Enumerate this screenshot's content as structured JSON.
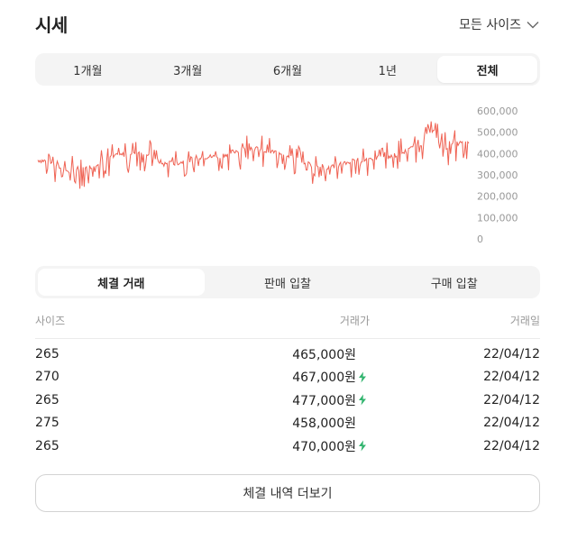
{
  "header": {
    "title": "시세",
    "size_select_label": "모든 사이즈"
  },
  "period_tabs": [
    {
      "label": "1개월",
      "active": false
    },
    {
      "label": "3개월",
      "active": false
    },
    {
      "label": "6개월",
      "active": false
    },
    {
      "label": "1년",
      "active": false
    },
    {
      "label": "전체",
      "active": true
    }
  ],
  "chart_data": {
    "type": "line",
    "line_color": "#ef6253",
    "ylim": [
      0,
      600000
    ],
    "y_ticks": [
      "600,000",
      "500,000",
      "400,000",
      "300,000",
      "200,000",
      "100,000",
      "0"
    ],
    "y_tick_values": [
      600000,
      500000,
      400000,
      300000,
      200000,
      100000,
      0
    ],
    "anchors": [
      [
        0,
        370000
      ],
      [
        10,
        365000
      ],
      [
        20,
        345000
      ],
      [
        35,
        315000
      ],
      [
        55,
        330000
      ],
      [
        75,
        375000
      ],
      [
        95,
        395000
      ],
      [
        110,
        410000
      ],
      [
        125,
        395000
      ],
      [
        140,
        350000
      ],
      [
        160,
        360000
      ],
      [
        180,
        385000
      ],
      [
        200,
        385000
      ],
      [
        215,
        405000
      ],
      [
        235,
        430000
      ],
      [
        255,
        410000
      ],
      [
        270,
        405000
      ],
      [
        285,
        385000
      ],
      [
        305,
        345000
      ],
      [
        325,
        335000
      ],
      [
        345,
        360000
      ],
      [
        365,
        375000
      ],
      [
        380,
        380000
      ],
      [
        395,
        390000
      ],
      [
        410,
        410000
      ],
      [
        420,
        430000
      ],
      [
        430,
        455000
      ],
      [
        435,
        500000
      ],
      [
        438,
        540000
      ],
      [
        445,
        470000
      ],
      [
        455,
        430000
      ],
      [
        465,
        445000
      ],
      [
        475,
        450000
      ],
      [
        480,
        448000
      ]
    ],
    "spike_amplitude": 55000,
    "noise": 12000
  },
  "trade_tabs": [
    {
      "label": "체결 거래",
      "active": true
    },
    {
      "label": "판매 입찰",
      "active": false
    },
    {
      "label": "구매 입찰",
      "active": false
    }
  ],
  "table": {
    "headers": {
      "size": "사이즈",
      "price": "거래가",
      "date": "거래일"
    },
    "rows": [
      {
        "size": "265",
        "price": "465,000원",
        "date": "22/04/12",
        "quick": false
      },
      {
        "size": "270",
        "price": "467,000원",
        "date": "22/04/12",
        "quick": true
      },
      {
        "size": "265",
        "price": "477,000원",
        "date": "22/04/12",
        "quick": true
      },
      {
        "size": "275",
        "price": "458,000원",
        "date": "22/04/12",
        "quick": false
      },
      {
        "size": "265",
        "price": "470,000원",
        "date": "22/04/12",
        "quick": true
      }
    ]
  },
  "more_button_label": "체결 내역 더보기",
  "colors": {
    "accent_green": "#31b46e",
    "chart_line": "#ef6253"
  }
}
